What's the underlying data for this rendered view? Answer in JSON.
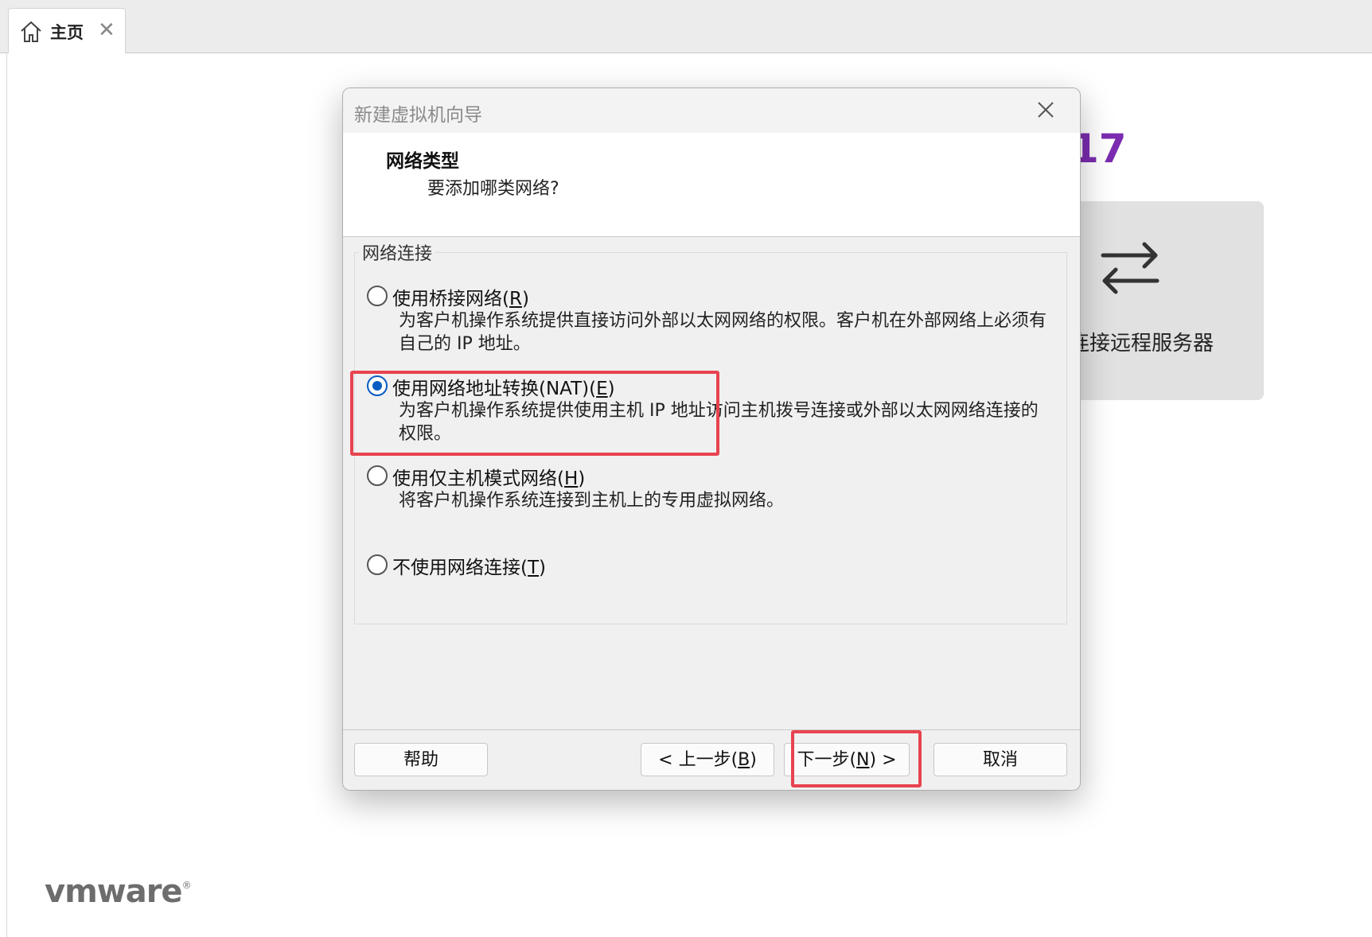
{
  "tab": {
    "label": "主页",
    "close": "✕"
  },
  "background": {
    "version_fragment": "17",
    "remote_card_label": "连接远程服务器",
    "brand": "vmware",
    "brand_mark": "®"
  },
  "dialog": {
    "title": "新建虚拟机向导",
    "header_title": "网络类型",
    "header_subtitle": "要添加哪类网络?",
    "group_label": "网络连接",
    "options": [
      {
        "label": "使用桥接网络(",
        "key": "R",
        "suffix": ")",
        "checked": false,
        "desc": "为客户机操作系统提供直接访问外部以太网网络的权限。客户机在外部网络上必须有自己的 IP 地址。"
      },
      {
        "label": "使用网络地址转换(NAT)(",
        "key": "E",
        "suffix": ")",
        "checked": true,
        "desc": "为客户机操作系统提供使用主机 IP 地址访问主机拨号连接或外部以太网网络连接的权限。"
      },
      {
        "label": "使用仅主机模式网络(",
        "key": "H",
        "suffix": ")",
        "checked": false,
        "desc": "将客户机操作系统连接到主机上的专用虚拟网络。"
      },
      {
        "label": "不使用网络连接(",
        "key": "T",
        "suffix": ")",
        "checked": false,
        "desc": ""
      }
    ],
    "buttons": {
      "help": "帮助",
      "back_prefix": "< 上一步(",
      "back_key": "B",
      "back_suffix": ")",
      "next_prefix": "下一步(",
      "next_key": "N",
      "next_suffix": ") >",
      "cancel": "取消"
    }
  },
  "colors": {
    "highlight": "#e8434f",
    "radio_selected": "#0a5bc2",
    "version_purple": "#7b2cb0"
  }
}
